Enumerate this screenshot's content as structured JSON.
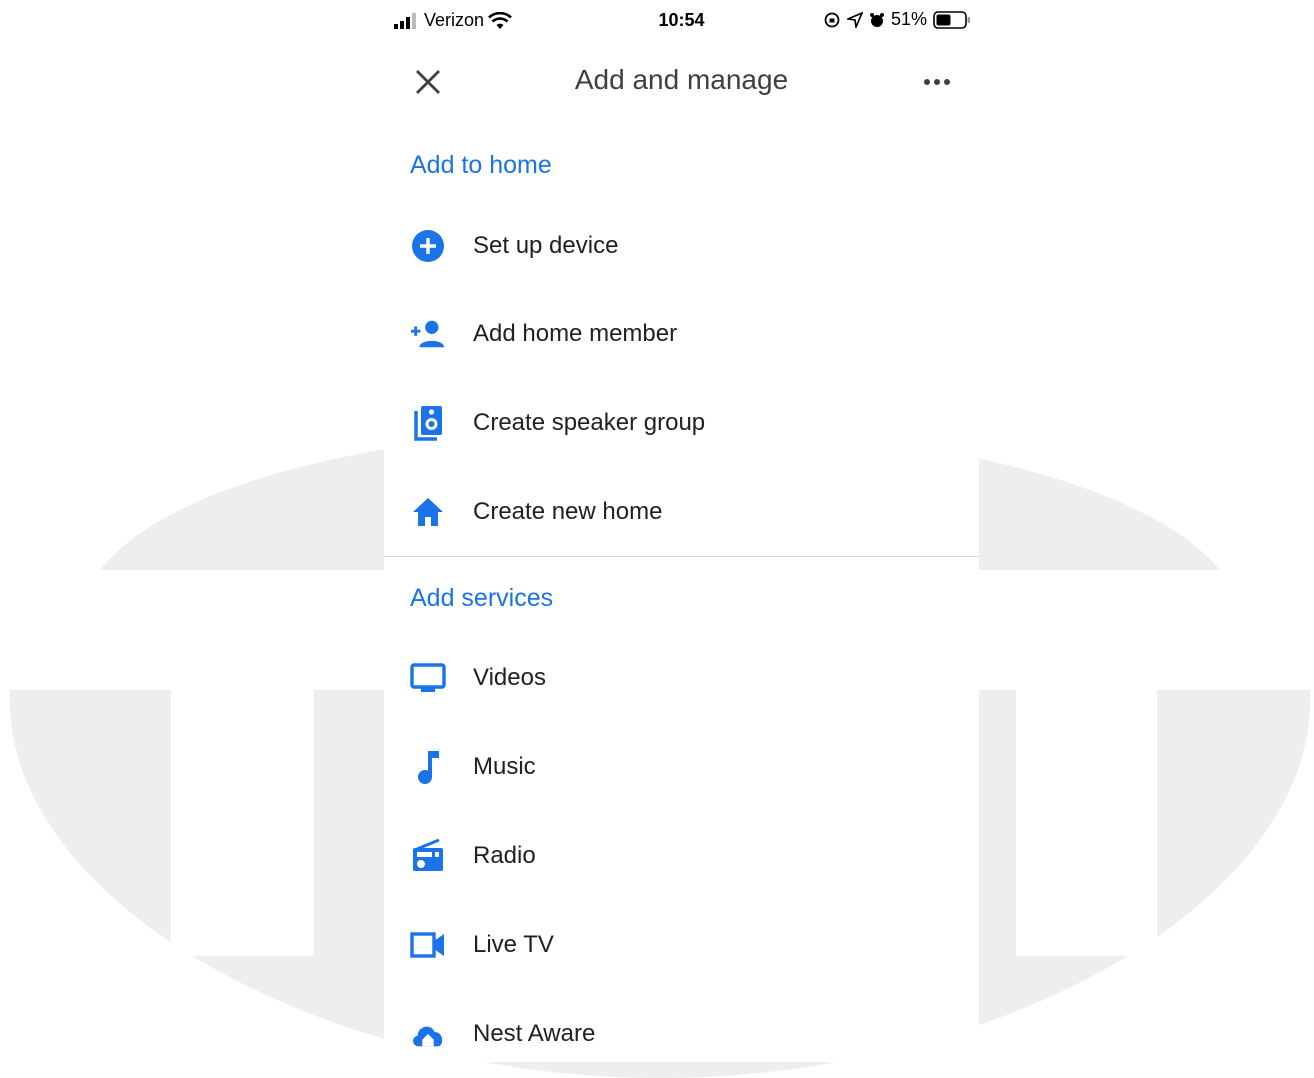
{
  "status_bar": {
    "carrier": "Verizon",
    "time": "10:54",
    "battery": "51%"
  },
  "header": {
    "title": "Add and manage"
  },
  "sections": [
    {
      "title": "Add to home",
      "items": [
        {
          "label": "Set up device",
          "icon": "add-circle-icon"
        },
        {
          "label": "Add home member",
          "icon": "person-add-icon"
        },
        {
          "label": "Create speaker group",
          "icon": "speaker-group-icon"
        },
        {
          "label": "Create new home",
          "icon": "home-icon"
        }
      ]
    },
    {
      "title": "Add services",
      "items": [
        {
          "label": "Videos",
          "icon": "tv-icon"
        },
        {
          "label": "Music",
          "icon": "music-note-icon"
        },
        {
          "label": "Radio",
          "icon": "radio-icon"
        },
        {
          "label": "Live TV",
          "icon": "videocam-icon"
        },
        {
          "label": "Nest Aware",
          "icon": "cloud-icon"
        }
      ]
    }
  ],
  "colors": {
    "accent": "#1a73e8",
    "text": "#202124",
    "title": "#3c4043",
    "watermark": "#eeeeee"
  }
}
